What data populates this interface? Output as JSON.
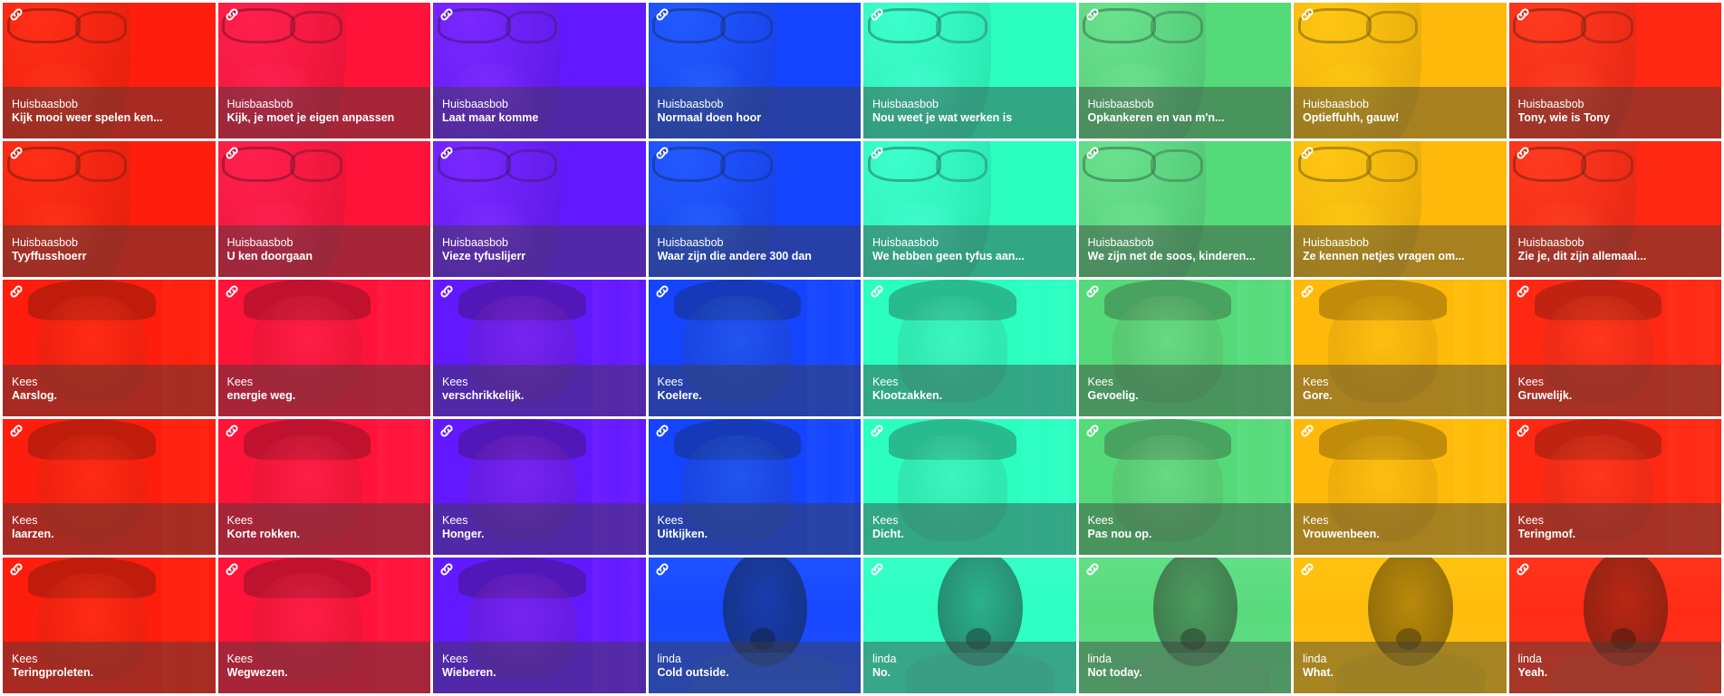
{
  "palette": [
    "#ff3d1f",
    "#ff2a5f",
    "#8c35ff",
    "#2e6cff",
    "#4dffd6",
    "#7de8a0",
    "#ffd21a",
    "#ff4a2a"
  ],
  "icons": {
    "link": "link-icon"
  },
  "clips": [
    {
      "speaker": "Huisbaasbob",
      "quote": "Kijk mooi weer spelen ken...",
      "face": "bob"
    },
    {
      "speaker": "Huisbaasbob",
      "quote": "Kijk, je moet je eigen anpassen",
      "face": "bob"
    },
    {
      "speaker": "Huisbaasbob",
      "quote": "Laat maar komme",
      "face": "bob"
    },
    {
      "speaker": "Huisbaasbob",
      "quote": "Normaal doen hoor",
      "face": "bob"
    },
    {
      "speaker": "Huisbaasbob",
      "quote": "Nou weet je wat werken is",
      "face": "bob"
    },
    {
      "speaker": "Huisbaasbob",
      "quote": "Opkankeren en van m'n...",
      "face": "bob"
    },
    {
      "speaker": "Huisbaasbob",
      "quote": "Optieffuhh, gauw!",
      "face": "bob"
    },
    {
      "speaker": "Huisbaasbob",
      "quote": "Tony, wie is Tony",
      "face": "bob"
    },
    {
      "speaker": "Huisbaasbob",
      "quote": "Tyyffusshoerr",
      "face": "bob"
    },
    {
      "speaker": "Huisbaasbob",
      "quote": "U ken doorgaan",
      "face": "bob"
    },
    {
      "speaker": "Huisbaasbob",
      "quote": "Vieze tyfuslijerr",
      "face": "bob"
    },
    {
      "speaker": "Huisbaasbob",
      "quote": "Waar zijn die andere 300 dan",
      "face": "bob"
    },
    {
      "speaker": "Huisbaasbob",
      "quote": "We hebben geen tyfus aan...",
      "face": "bob"
    },
    {
      "speaker": "Huisbaasbob",
      "quote": "We zijn net de soos, kinderen...",
      "face": "bob"
    },
    {
      "speaker": "Huisbaasbob",
      "quote": "Ze kennen netjes vragen om...",
      "face": "bob"
    },
    {
      "speaker": "Huisbaasbob",
      "quote": "Zie je, dit zijn allemaal...",
      "face": "bob"
    },
    {
      "speaker": "Kees",
      "quote": "Aarslog.",
      "face": "kees"
    },
    {
      "speaker": "Kees",
      "quote": "energie weg.",
      "face": "kees"
    },
    {
      "speaker": "Kees",
      "quote": "verschrikkelijk.",
      "face": "kees"
    },
    {
      "speaker": "Kees",
      "quote": "Koelere.",
      "face": "kees"
    },
    {
      "speaker": "Kees",
      "quote": "Klootzakken.",
      "face": "kees"
    },
    {
      "speaker": "Kees",
      "quote": "Gevoelig.",
      "face": "kees"
    },
    {
      "speaker": "Kees",
      "quote": "Gore.",
      "face": "kees"
    },
    {
      "speaker": "Kees",
      "quote": "Gruwelijk.",
      "face": "kees"
    },
    {
      "speaker": "Kees",
      "quote": "laarzen.",
      "face": "kees"
    },
    {
      "speaker": "Kees",
      "quote": "Korte rokken.",
      "face": "kees"
    },
    {
      "speaker": "Kees",
      "quote": "Honger.",
      "face": "kees"
    },
    {
      "speaker": "Kees",
      "quote": "Uitkijken.",
      "face": "kees"
    },
    {
      "speaker": "Kees",
      "quote": "Dicht.",
      "face": "kees"
    },
    {
      "speaker": "Kees",
      "quote": "Pas nou op.",
      "face": "kees"
    },
    {
      "speaker": "Kees",
      "quote": "Vrouwenbeen.",
      "face": "kees"
    },
    {
      "speaker": "Kees",
      "quote": "Teringmof.",
      "face": "kees"
    },
    {
      "speaker": "Kees",
      "quote": "Teringproleten.",
      "face": "kees"
    },
    {
      "speaker": "Kees",
      "quote": "Wegwezen.",
      "face": "kees"
    },
    {
      "speaker": "Kees",
      "quote": "Wieberen.",
      "face": "kees"
    },
    {
      "speaker": "linda",
      "quote": "Cold outside.",
      "face": "linda"
    },
    {
      "speaker": "linda",
      "quote": "No.",
      "face": "linda"
    },
    {
      "speaker": "linda",
      "quote": "Not today.",
      "face": "linda"
    },
    {
      "speaker": "linda",
      "quote": "What.",
      "face": "linda"
    },
    {
      "speaker": "linda",
      "quote": "Yeah.",
      "face": "linda"
    }
  ]
}
